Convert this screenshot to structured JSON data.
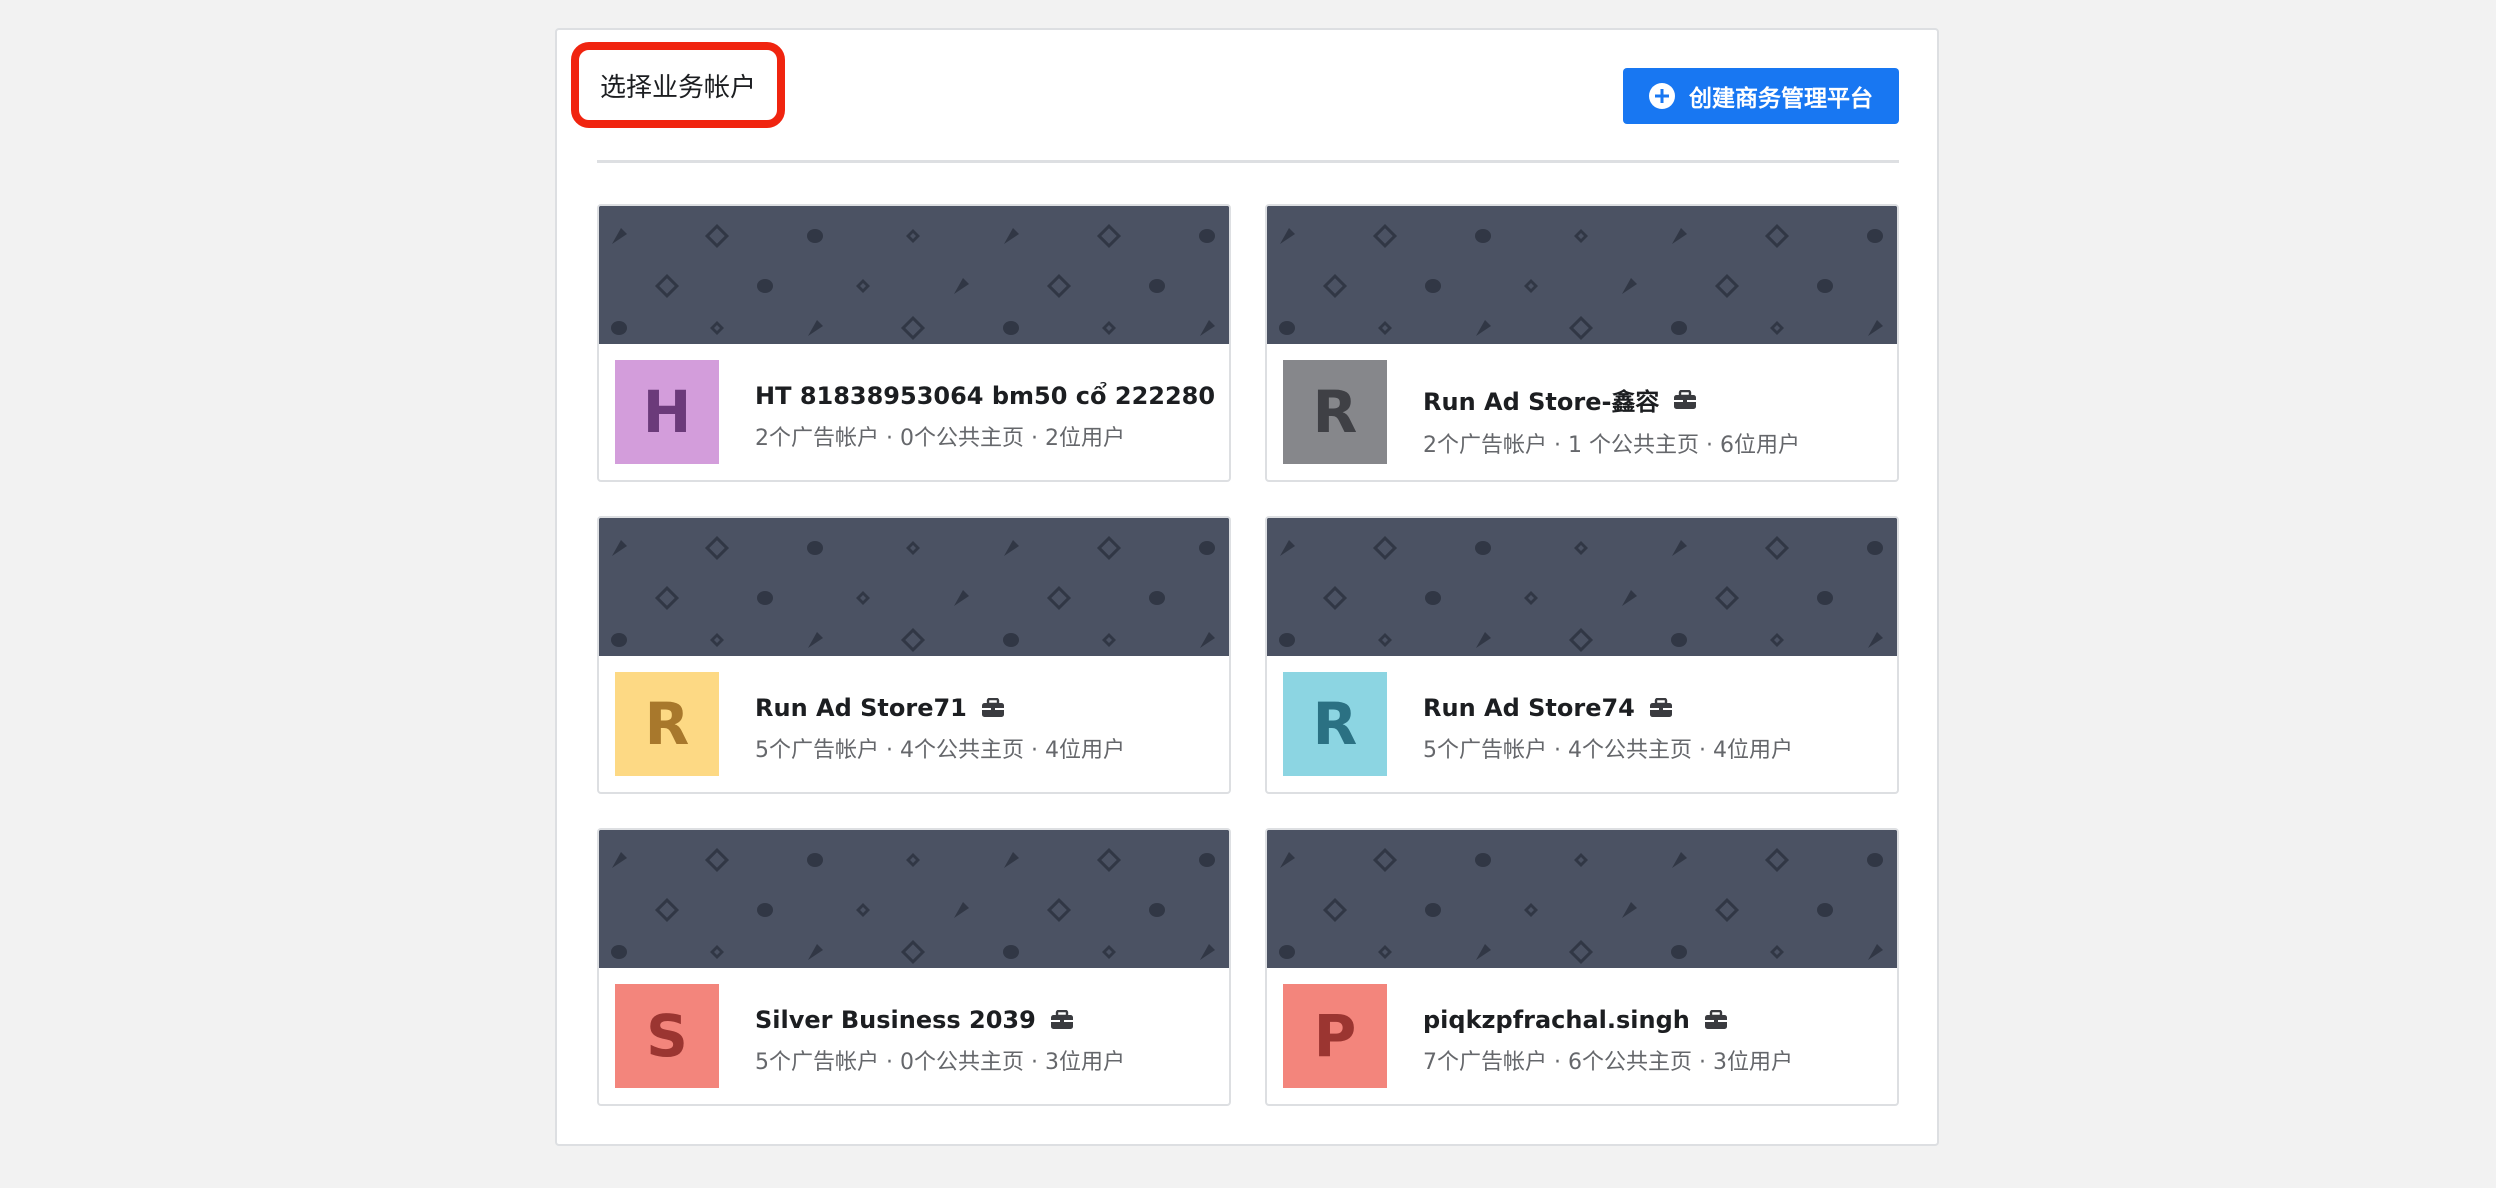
{
  "header": {
    "title": "选择业务帐户",
    "create_button_label": "创建商务管理平台"
  },
  "businesses": [
    {
      "name": "HT 81838953064 bm50 cổ 222280",
      "initial": "H",
      "avatar_bg": "#d39ddb",
      "avatar_fg": "#6b3a7a",
      "meta": "2个广告帐户 · 0个公共主页 · 2位用户"
    },
    {
      "name": "Run Ad Store-鑫容",
      "initial": "R",
      "avatar_bg": "#86878b",
      "avatar_fg": "#3f4045",
      "meta": "2个广告帐户 · 1 个公共主页 · 6位用户"
    },
    {
      "name": "Run Ad Store71",
      "initial": "R",
      "avatar_bg": "#fdd984",
      "avatar_fg": "#a8782c",
      "meta": "5个广告帐户 · 4个公共主页 · 4位用户"
    },
    {
      "name": "Run Ad Store74",
      "initial": "R",
      "avatar_bg": "#8cd5e2",
      "avatar_fg": "#2b7183",
      "meta": "5个广告帐户 · 4个公共主页 · 4位用户"
    },
    {
      "name": "Silver Business 2039",
      "initial": "S",
      "avatar_bg": "#f3857c",
      "avatar_fg": "#9b3531",
      "meta": "5个广告帐户 · 0个公共主页 · 3位用户"
    },
    {
      "name": "piqkzpfrachal.singh",
      "initial": "P",
      "avatar_bg": "#f3857c",
      "avatar_fg": "#9b3531",
      "meta": "7个广告帐户 · 6个公共主页 · 3位用户"
    }
  ],
  "colors": {
    "primary": "#1877f2",
    "highlight_border": "#f0240f",
    "cover": "#4b5263"
  }
}
